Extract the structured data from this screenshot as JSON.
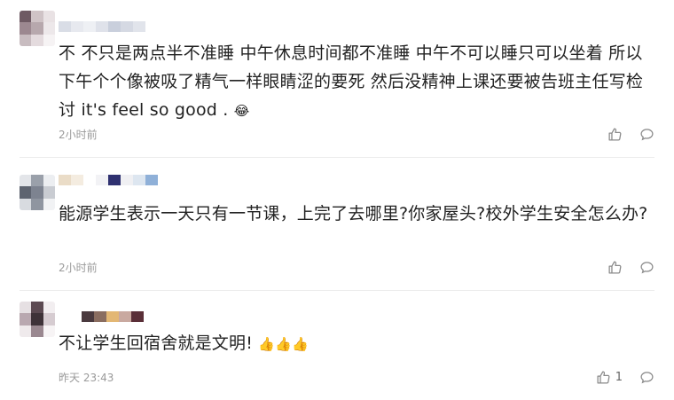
{
  "comments": [
    {
      "text": "不 不只是两点半不准睡 中午休息时间都不准睡 中午不可以睡只可以坐着 所以下午个个像被吸了精气一样眼睛涩的要死 然后没精神上课还要被告班主任写检讨 it's feel so good .",
      "emoji": "😂",
      "time": "2小时前",
      "likes": ""
    },
    {
      "text": "能源学生表示一天只有一节课，上完了去哪里?你家屋头?校外学生安全怎么办?",
      "emoji": "",
      "time": "2小时前",
      "likes": ""
    },
    {
      "text": "不让学生回宿舍就是文明!",
      "emoji": "👍👍👍",
      "time": "昨天 23:43",
      "likes": "1"
    }
  ],
  "icons": {
    "like": "thumbs-up-icon",
    "reply": "comment-bubble-icon"
  },
  "colors": {
    "text": "#222222",
    "meta": "#9a9a9a",
    "icon": "#8a8a8a",
    "divider": "#ececec"
  }
}
